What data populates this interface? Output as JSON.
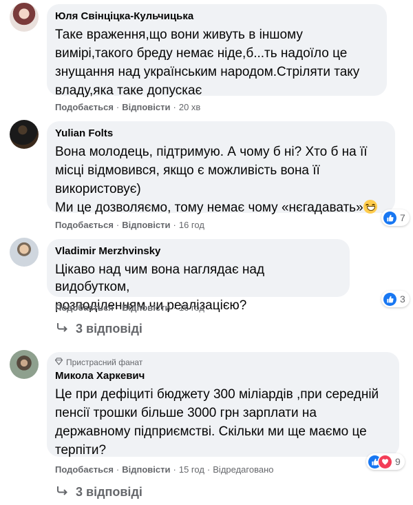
{
  "comments": [
    {
      "author": "Юля Свінціцка-Кульчицька",
      "lines": [
        "Таке враження,що вони живуть в іншому",
        "вимірі,такого бреду немає ніде,б...ть надоїло це",
        "знущання над українським народом.Стріляти таку",
        "владу,яка таке допускає"
      ],
      "like_label": "Подобається",
      "reply_label": "Відповісти",
      "time": "20 хв"
    },
    {
      "author": "Yulian Folts",
      "lines": [
        "Вона молодець, підтримую. А чому б ні? Хто б на її",
        "місці відмовився, якщо є можливість вона її",
        "використовує)",
        "Ми це дозволяємо, тому немає чому «нєгадавать»"
      ],
      "like_label": "Подобається",
      "reply_label": "Відповісти",
      "time": "16 год",
      "reaction_count": "7",
      "trailing_emoji": "grinning-face-emoji"
    },
    {
      "author": "Vladimir Merzhvinsky",
      "lines": [
        "Цікаво над чим вона наглядає над видобутком,",
        "розподіленням чи реалізацією?"
      ],
      "like_label": "Подобається",
      "reply_label": "Відповісти",
      "time": "16 год",
      "reaction_count": "3",
      "replies_label": "3 відповіді"
    },
    {
      "badge": "Пристрасний фанат",
      "author": "Микола Харкевич",
      "lines": [
        "Це при дефіциті бюджету 300 міліардів ,при середній",
        "пенсії трошки більше 3000 грн зарплати на",
        "державному підприємстві. Скільки ми ще маємо це",
        "терпіти?"
      ],
      "like_label": "Подобається",
      "reply_label": "Відповісти",
      "time": "15 год",
      "edited_label": "Відредаговано",
      "reaction_count": "9",
      "replies_label": "3 відповіді"
    }
  ],
  "colors": {
    "bubble": "#f0f2f5",
    "secondary_text": "#65676b",
    "like_blue": "#1877f2",
    "love_red": "#f33e58"
  },
  "icons": {
    "like": "like-icon",
    "love": "love-icon",
    "reply_arrow": "reply-arrow-icon",
    "badge": "diamond-badge-icon"
  }
}
